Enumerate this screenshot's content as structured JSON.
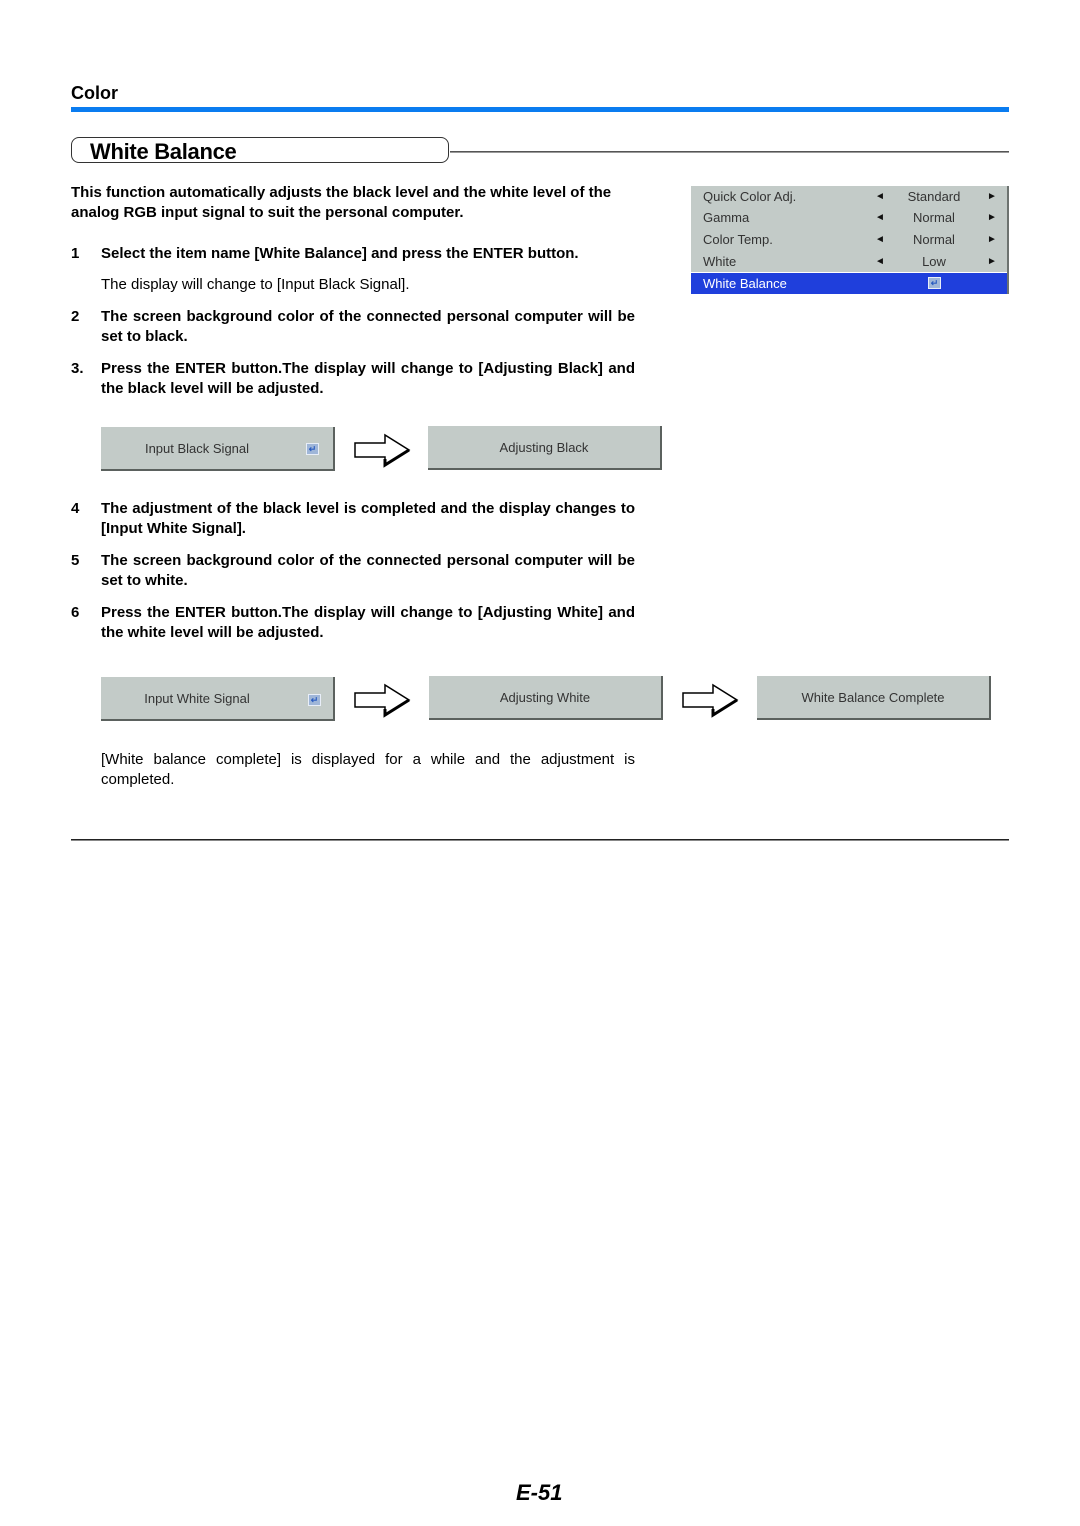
{
  "header": {
    "section": "Color",
    "accent_color": "#0a7cf0",
    "title": "White Balance"
  },
  "intro": "This function automatically adjusts the black level and the white level of the analog RGB input signal to suit the personal computer.",
  "steps": [
    {
      "num": "1",
      "text": "Select the item name [White Balance] and press the ENTER button.",
      "note": "The display will change to [Input Black Signal]."
    },
    {
      "num": "2",
      "text": "The screen background color of the connected personal computer will be set to black."
    },
    {
      "num": "3.",
      "text": "Press the ENTER button.The display will change to [Adjusting Black] and the black level will be adjusted."
    },
    {
      "num": "4",
      "text": "The adjustment of the black level is completed and the display changes to [Input White Signal]."
    },
    {
      "num": "5",
      "text": "The screen background color of the connected personal computer will be set to white."
    },
    {
      "num": "6",
      "text": "Press the ENTER button.The display will change to [Adjusting White] and the white level will be adjusted."
    }
  ],
  "osd_menu": {
    "rows": [
      {
        "label": "Quick Color Adj.",
        "value": "Standard"
      },
      {
        "label": "Gamma",
        "value": "Normal"
      },
      {
        "label": "Color Temp.",
        "value": "Normal"
      },
      {
        "label": "White",
        "value": "Low"
      }
    ],
    "selected": {
      "label": "White Balance",
      "icon": "enter-icon"
    },
    "left_arrow": "◄",
    "right_arrow": "►",
    "highlight_color": "#1f3fdc"
  },
  "black_sequence": [
    "Input Black Signal",
    "Adjusting Black"
  ],
  "white_sequence": [
    "Input White Signal",
    "Adjusting White",
    "White Balance Complete"
  ],
  "enter_glyph": "↵",
  "closing": "[White balance complete] is displayed for a while and the adjustment is completed.",
  "page_number": "E-51"
}
